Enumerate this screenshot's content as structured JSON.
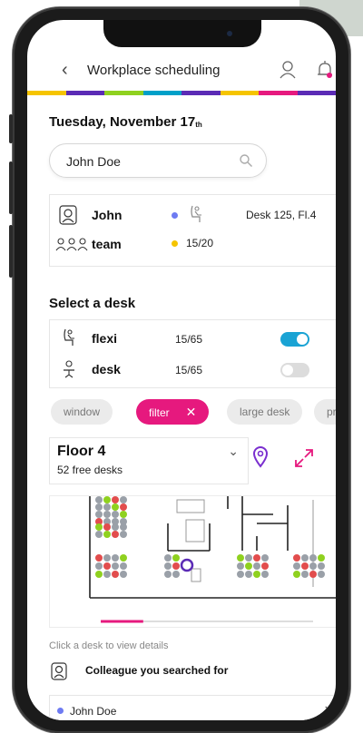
{
  "header": {
    "back_icon": "‹",
    "title": "Workplace scheduling"
  },
  "brand_stripe": [
    "#f5c400",
    "#5b2bb5",
    "#8fd11f",
    "#00a0c8",
    "#5b2bb5",
    "#f5c400",
    "#e6197e",
    "#5b2bb5"
  ],
  "colors": {
    "accent": "#e6197e",
    "toggle_on": "#1aa3d4",
    "toggle_off": "#dcdcdc",
    "indicator_blue": "#6e7bf2",
    "indicator_yellow": "#f5c400",
    "pin_purple": "#7a2ecf"
  },
  "date": {
    "text": "Tuesday, November 17",
    "suffix": "th"
  },
  "search": {
    "value": "John Doe"
  },
  "person": {
    "name": "John",
    "location": "Desk 125, Fl.4"
  },
  "team": {
    "label": "team",
    "count": "15/20"
  },
  "select_desk": {
    "title": "Select a desk",
    "types": [
      {
        "label": "flexi",
        "count": "15/65",
        "enabled": true
      },
      {
        "label": "desk",
        "count": "15/65",
        "enabled": false
      }
    ]
  },
  "filters": [
    {
      "label": "window",
      "active": false
    },
    {
      "label": "filter",
      "active": true,
      "remove": "✕"
    },
    {
      "label": "large desk",
      "active": false
    },
    {
      "label": "printer",
      "active": false
    }
  ],
  "floor": {
    "name": "Floor 4",
    "free": "52 free desks",
    "chevron": "⌄"
  },
  "map_progress": 0.2,
  "hint": "Click a desk to view details",
  "colleague": {
    "title": "Colleague you searched for",
    "name": "John Doe",
    "chevron": "›"
  }
}
